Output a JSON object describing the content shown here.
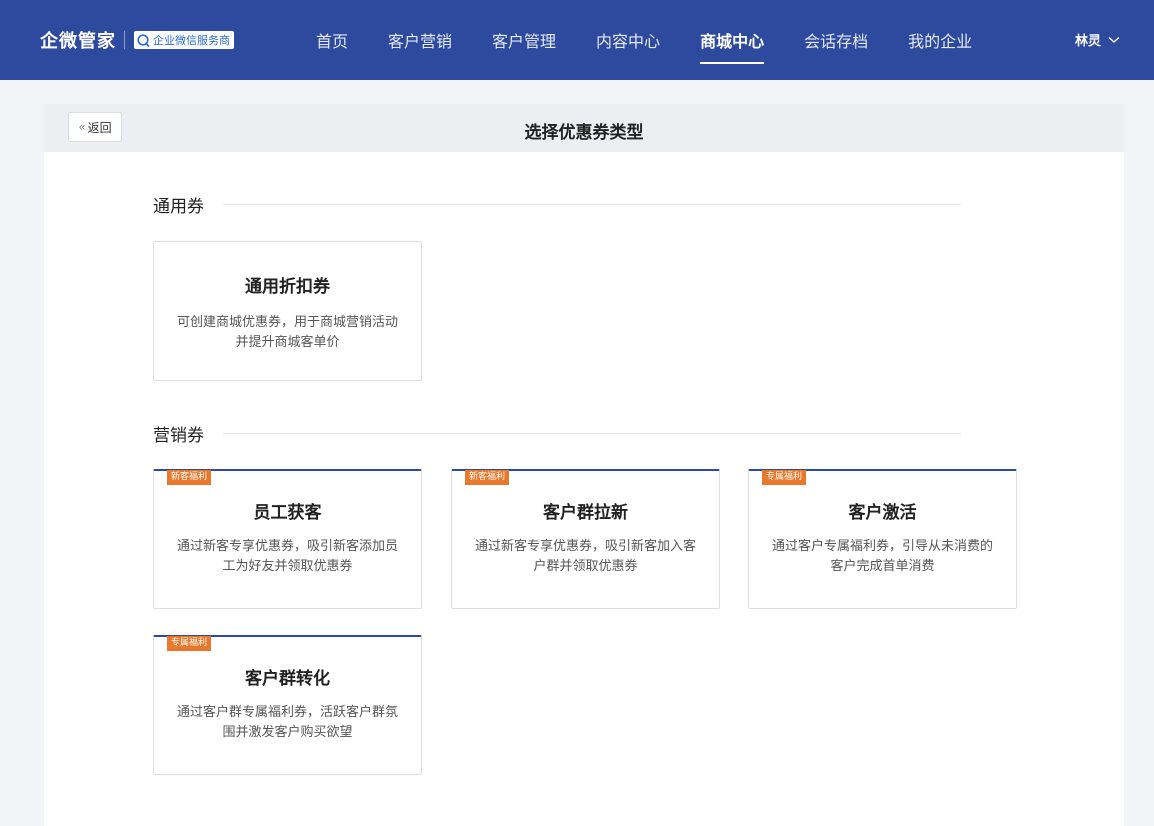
{
  "header": {
    "brand_name": "企微管家",
    "brand_badge": "企业微信服务商",
    "nav": [
      {
        "label": "首页"
      },
      {
        "label": "客户营销"
      },
      {
        "label": "客户管理"
      },
      {
        "label": "内容中心"
      },
      {
        "label": "商城中心",
        "active": true
      },
      {
        "label": "会话存档"
      },
      {
        "label": "我的企业"
      }
    ],
    "user_name": "林灵"
  },
  "page": {
    "back_label": "返回",
    "title": "选择优惠券类型"
  },
  "sections": [
    {
      "title": "通用券",
      "cards": [
        {
          "title": "通用折扣券",
          "desc": "可创建商城优惠券，用于商城营销活动并提升商城客单价",
          "tag": ""
        }
      ]
    },
    {
      "title": "营销券",
      "cards": [
        {
          "title": "员工获客",
          "desc": "通过新客专享优惠券，吸引新客添加员工为好友并领取优惠券",
          "tag": "新客福利"
        },
        {
          "title": "客户群拉新",
          "desc": "通过新客专享优惠券，吸引新客加入客户群并领取优惠券",
          "tag": "新客福利"
        },
        {
          "title": "客户激活",
          "desc": "通过客户专属福利券，引导从未消费的客户完成首单消费",
          "tag": "专属福利"
        },
        {
          "title": "客户群转化",
          "desc": "通过客户群专属福利券，活跃客户群氛围并激发客户购买欲望",
          "tag": "专属福利"
        }
      ]
    }
  ],
  "colors": {
    "header_bg": "#2e4a9e",
    "tag_bg": "#e8782b",
    "page_bg": "#f3f4f7"
  }
}
